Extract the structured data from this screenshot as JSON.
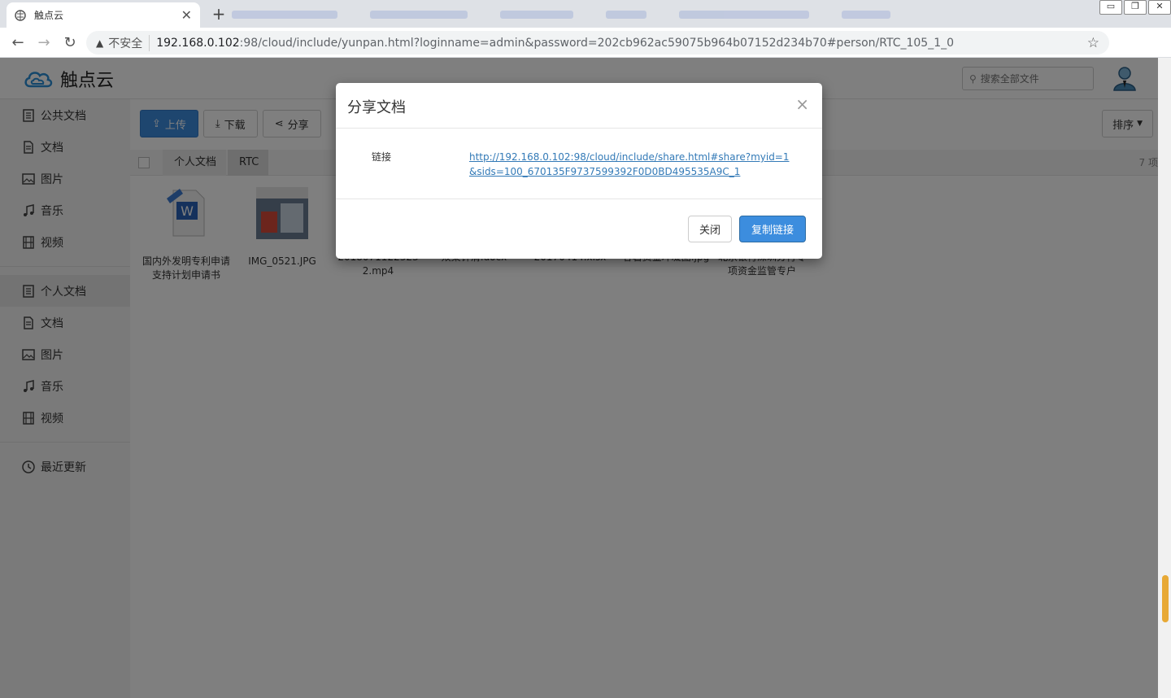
{
  "browser": {
    "tab_title": "触点云",
    "tab_close": "✕",
    "new_tab": "+",
    "back": "←",
    "forward": "→",
    "reload": "↻",
    "insecure_label": "不安全",
    "url_host": "192.168.0.102",
    "url_rest": ":98/cloud/include/yunpan.html?loginname=admin&password=202cb962ac59075b964b07152d234b70#person/RTC_105_1_0",
    "star": "☆",
    "menu": "⋮"
  },
  "app": {
    "brand": "触点云",
    "search_placeholder": "搜索全部文件"
  },
  "sidebar": {
    "public": [
      {
        "label": "公共文档",
        "icon": "document-list-icon"
      },
      {
        "label": "文档",
        "icon": "document-icon"
      },
      {
        "label": "图片",
        "icon": "image-icon"
      },
      {
        "label": "音乐",
        "icon": "music-icon"
      },
      {
        "label": "视频",
        "icon": "film-icon"
      }
    ],
    "personal": [
      {
        "label": "个人文档",
        "icon": "document-list-icon"
      },
      {
        "label": "文档",
        "icon": "document-icon"
      },
      {
        "label": "图片",
        "icon": "image-icon"
      },
      {
        "label": "音乐",
        "icon": "music-icon"
      },
      {
        "label": "视频",
        "icon": "film-icon"
      }
    ],
    "recent": {
      "label": "最近更新",
      "icon": "clock-icon"
    }
  },
  "toolbar": {
    "upload": "上传",
    "download": "下载",
    "share": "分享",
    "sort": "排序"
  },
  "breadcrumb": {
    "root": "个人文档",
    "current": "RTC",
    "count": "7 项"
  },
  "files": [
    {
      "name": "国内外发明专利申请支持计划申请书"
    },
    {
      "name": "IMG_0521.JPG"
    },
    {
      "name": "2018071122323 2.mp4"
    },
    {
      "name": "双渠针清.docx"
    },
    {
      "name": "20170414.xlsx"
    },
    {
      "name": "谷暑资金冲凝图.jpg"
    },
    {
      "name": "北京银行深圳分行专项资金监管专户"
    }
  ],
  "modal": {
    "title": "分享文档",
    "close_x": "×",
    "link_label": "链接",
    "link_url": "http://192.168.0.102:98/cloud/include/share.html#share?myid=1&sids=100_670135F9737599392F0D0BD495535A9C_1",
    "close_button": "关闭",
    "copy_button": "复制链接"
  },
  "colors": {
    "primary": "#3c8dde",
    "link": "#337ab7",
    "scroll_thumb": "#e8a935"
  }
}
